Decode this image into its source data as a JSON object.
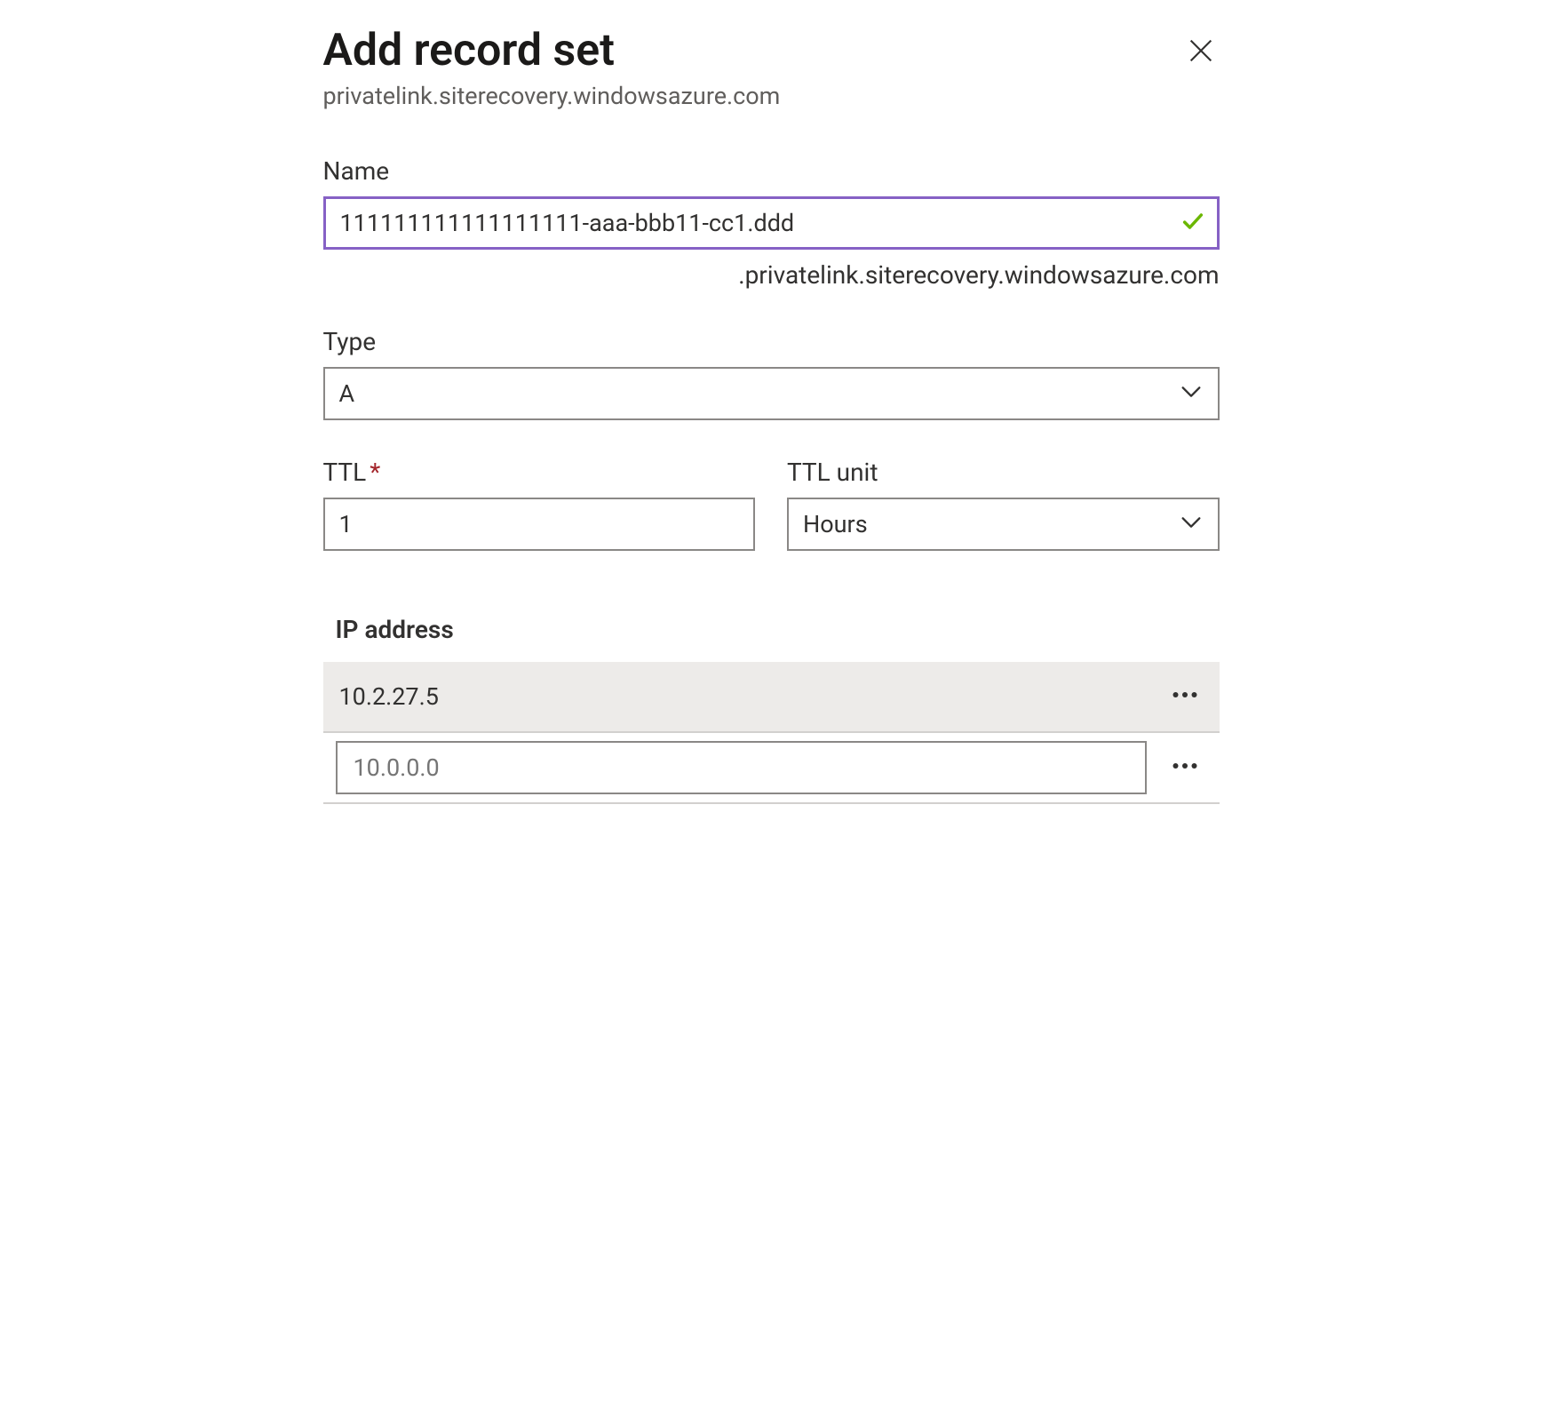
{
  "header": {
    "title": "Add record set",
    "subtitle": "privatelink.siterecovery.windowsazure.com"
  },
  "name": {
    "label": "Name",
    "value": "111111111111111111-aaa-bbb11-cc1.ddd",
    "suffix": ".privatelink.siterecovery.windowsazure.com"
  },
  "type": {
    "label": "Type",
    "value": "A"
  },
  "ttl": {
    "label": "TTL",
    "value": "1",
    "unit_label": "TTL unit",
    "unit_value": "Hours"
  },
  "ip": {
    "heading": "IP address",
    "existing": "10.2.27.5",
    "placeholder": "10.0.0.0"
  },
  "icons": {
    "close": "close-icon",
    "check": "check-icon",
    "chevron": "chevron-down-icon",
    "more": "more-icon"
  }
}
